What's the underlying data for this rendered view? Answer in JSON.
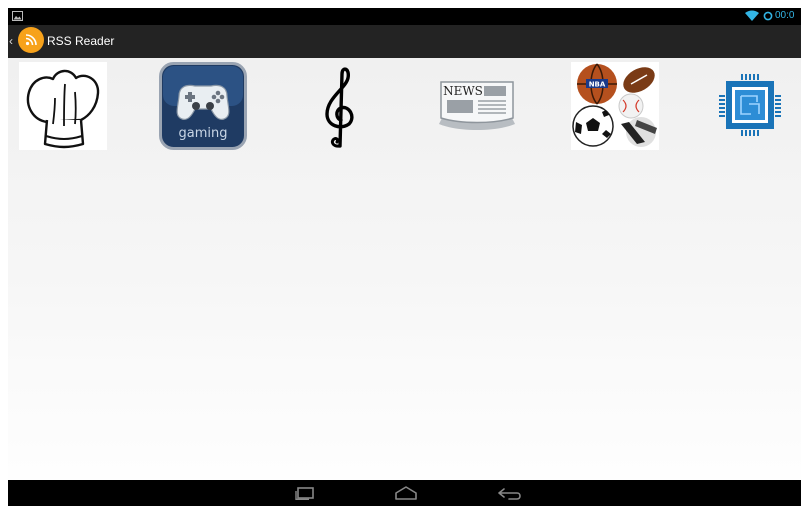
{
  "status_bar": {
    "time": "00:0",
    "icons": [
      "image-notification-icon",
      "wifi-icon",
      "sync-icon"
    ],
    "accent_color": "#33b5e5"
  },
  "action_bar": {
    "title": "RSS Reader",
    "icon": "rss-icon",
    "logo_color": "#f7a21b"
  },
  "categories": [
    {
      "icon": "chef-hat-icon"
    },
    {
      "icon": "gamepad-icon",
      "label": "gaming"
    },
    {
      "icon": "treble-clef-icon"
    },
    {
      "icon": "newspaper-icon",
      "label": "NEWS"
    },
    {
      "icon": "sports-balls-icon",
      "label": "NBA"
    },
    {
      "icon": "chip-icon"
    }
  ],
  "nav_bar": {
    "buttons": [
      "recent-apps-icon",
      "home-icon",
      "back-icon"
    ]
  }
}
